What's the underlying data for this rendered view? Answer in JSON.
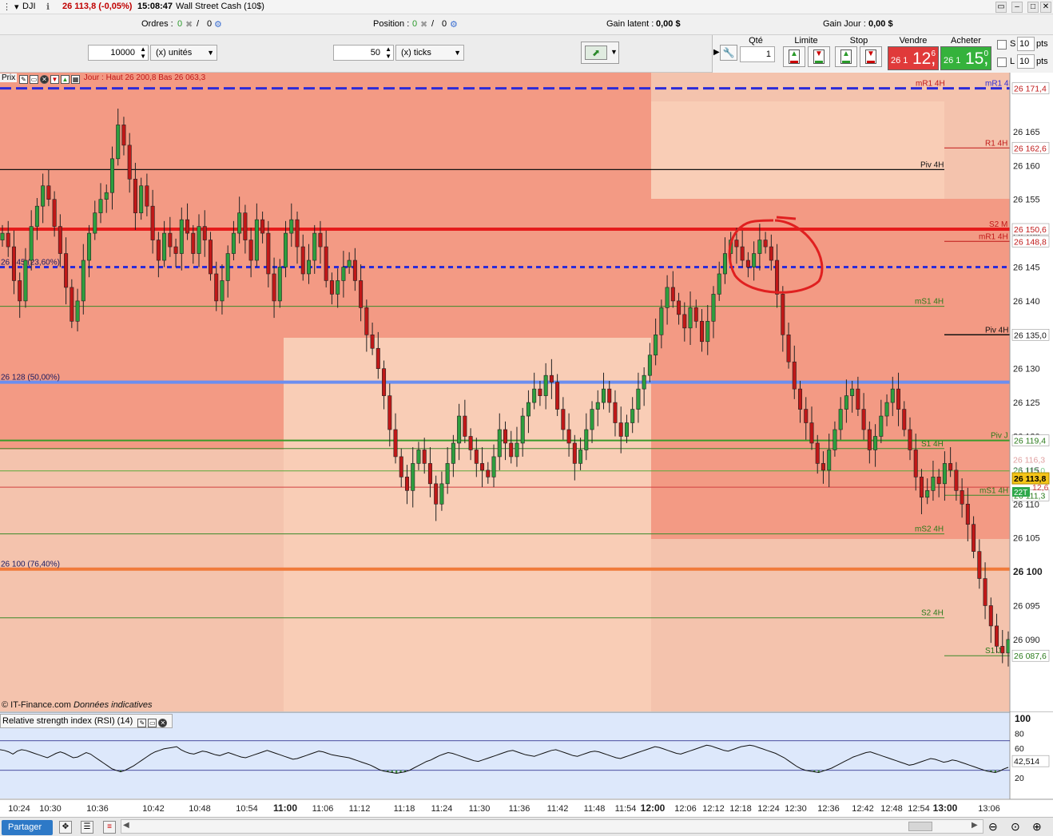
{
  "titlebar": {
    "symbol": "DJI",
    "price_change": "26 113,8 (-0,05%)",
    "time": "15:08:47",
    "instrument": "Wall Street Cash (10$)"
  },
  "statusbar": {
    "orders_label": "Ordres :",
    "orders_value": "0",
    "orders_value2": "0",
    "position_label": "Position :",
    "position_value": "0",
    "position_value2": "0",
    "gain_latent_label": "Gain latent :",
    "gain_latent_value": "0,00 $",
    "gain_jour_label": "Gain Jour :",
    "gain_jour_value": "0,00 $"
  },
  "tradebar": {
    "quantity_value": "10000",
    "quantity_unit": "(x) unités",
    "ticks_value": "50",
    "ticks_unit": "(x) ticks",
    "qte_label": "Qté",
    "qte_value": "1",
    "limite_label": "Limite",
    "stop_label": "Stop",
    "vendre_label": "Vendre",
    "acheter_label": "Acheter",
    "sell_small": "26 1",
    "sell_big": "12,",
    "sell_sup": "6",
    "buy_small": "26 1",
    "buy_big": "15,",
    "buy_sup": "0",
    "s_label": "S",
    "l_label": "L",
    "pts_value_s": "10",
    "pts_value_l": "10",
    "pts_label": "pts"
  },
  "chart_header": {
    "prix_label": "Prix",
    "jour_info": "Jour : Haut 26 200,8 Bas 26 063,3"
  },
  "footer_note": {
    "copyright": "© IT-Finance.com",
    "note": "Données indicatives"
  },
  "rsi_header": {
    "label": "Relative strength index (RSI) (14)"
  },
  "bottombar": {
    "partager_label": "Partager"
  },
  "colors": {
    "zone_dark": "#f39a84",
    "zone_light": "#f9cdb6",
    "zone_base": "#f4c3ad",
    "resistance_red": "#e51b1b",
    "fib_blue_dashed": "#2b2bd9",
    "fib_50_blue": "#6b8ef0",
    "fib_76_orange": "#f07a3a",
    "candle_up": "#2e9e3e",
    "candle_down": "#c01818",
    "annotation_circle": "#e02020"
  },
  "chart_data": {
    "type": "candlestick",
    "y_axis_ticks": [
      26165,
      26160,
      26155,
      26150,
      26145,
      26140,
      26135,
      26130,
      26125,
      26120,
      26115,
      26110,
      26105,
      26100,
      26095,
      26090
    ],
    "y_axis_tick_labels": [
      "26 165",
      "26 160",
      "26 155",
      "26 150",
      "26 145",
      "26 140",
      "26 135",
      "26 130",
      "26 125",
      "26 120",
      "26 115",
      "26 110",
      "26 105",
      "26 100",
      "26 095",
      "26 090"
    ],
    "ylim": [
      26083.5,
      26172.3
    ],
    "x_axis_tick_labels": [
      "10:24",
      "10:30",
      "10:36",
      "10:42",
      "10:48",
      "10:54",
      "11:00",
      "11:06",
      "11:12",
      "11:18",
      "11:24",
      "11:30",
      "11:36",
      "11:42",
      "11:48",
      "11:54",
      "12:00",
      "12:06",
      "12:12",
      "12:18",
      "12:24",
      "12:30",
      "12:36",
      "12:42",
      "12:48",
      "12:54",
      "13:00",
      "13:06"
    ],
    "x_axis_bold": [
      "11:00",
      "12:00",
      "13:00"
    ],
    "horizontal_levels": [
      {
        "label": "mR1 4H",
        "value": 26171.4,
        "axis_label": "26 171,4"
      },
      {
        "label": "R1 4H",
        "value": 26162.6,
        "axis_label": "26 162,6"
      },
      {
        "label": "Piv 4H",
        "value": 26159.4
      },
      {
        "label": "S2 M",
        "value": 26150.6,
        "axis_label": "26 150,6"
      },
      {
        "label": "mR1 4H",
        "value": 26148.8,
        "axis_label": "26 148,8"
      },
      {
        "label": "26 145 (23,60%)",
        "value": 26145
      },
      {
        "label": "mS1 4H",
        "value": 26139.2
      },
      {
        "label": "Piv 4H",
        "value": 26135.0,
        "axis_label": "26 135,0"
      },
      {
        "label": "26 128 (50,00%)",
        "value": 26128
      },
      {
        "label": "Piv J",
        "value": 26119.4,
        "axis_label": "26 119,4"
      },
      {
        "label": "S1 4H",
        "value": 26118.2
      },
      {
        "label": "mS1 4H",
        "value": 26111.3,
        "axis_label": "26 111,3"
      },
      {
        "label": "mS2 4H",
        "value": 26105.6
      },
      {
        "label": "26 100 (76,40%)",
        "value": 26100.4
      },
      {
        "label": "S2 4H",
        "value": 26093.2
      },
      {
        "label": "S1 J",
        "value": 26087.6,
        "axis_label": "26 087,6"
      }
    ],
    "axis_extra_labels": [
      "26 116,3",
      "26 115,0",
      "12,6"
    ],
    "current_price": {
      "value": 26113.8,
      "label": "26 113,8",
      "tag": "22T"
    },
    "series": [
      {
        "close": [
          26150,
          26148,
          26143,
          26140,
          26146,
          26151,
          26154,
          26157,
          26155,
          26151,
          26147,
          26142,
          26137,
          26140,
          26146,
          26150,
          26153,
          26155,
          26156,
          26161,
          26166,
          26163,
          26158,
          26153,
          26157,
          26154,
          26149,
          26146,
          26150,
          26148,
          26147,
          26152,
          26150,
          26147,
          26151,
          26149,
          26144,
          26140,
          26143,
          26147,
          26150,
          26153,
          26149,
          26146,
          26152,
          26150,
          26144,
          26140,
          26145,
          26150,
          26152,
          26148,
          26144,
          26146,
          26150,
          26148,
          26143,
          26141,
          26143,
          26145,
          26146,
          26143,
          26139,
          26135,
          26133,
          26130,
          26126,
          26121,
          26117,
          26114,
          26112,
          26116,
          26118,
          26116,
          26113,
          26110,
          26113,
          26116,
          26119,
          26123,
          26120,
          26118,
          26116,
          26115,
          26114,
          26117,
          26121,
          26119,
          26117,
          26119,
          26123,
          26125,
          26127,
          26126,
          26129,
          26128,
          26124,
          26121,
          26119,
          26116,
          26118,
          26121,
          26124,
          26125,
          26127,
          26125,
          26122,
          26120,
          26122,
          26124,
          26127,
          26129,
          26132,
          26135,
          26139,
          26142,
          26140,
          26138,
          26136,
          26139,
          26137,
          26134,
          26137,
          26141,
          26144,
          26147,
          26149,
          26148,
          26146,
          26145,
          26147,
          26149,
          26148,
          26146,
          26141,
          26135,
          26131,
          26127,
          26124,
          26122,
          26119,
          26116,
          26115,
          26118,
          26121,
          26124,
          26126,
          26127,
          26124,
          26121,
          26118,
          26120,
          26123,
          26125,
          26127,
          26124,
          26121,
          26118,
          26114,
          26111,
          26112,
          26114,
          26113,
          26116,
          26115,
          26112,
          26110,
          26107,
          26103,
          26099,
          26095,
          26092,
          26089,
          26088,
          26090
        ]
      }
    ],
    "rsi": {
      "ticks": [
        100,
        80,
        60,
        40,
        20
      ],
      "levels": [
        70,
        30
      ],
      "current_label": "42,514",
      "ylim": [
        10,
        100
      ],
      "values": [
        58,
        57,
        55,
        52,
        56,
        58,
        57,
        55,
        53,
        51,
        49,
        47,
        50,
        53,
        55,
        53,
        50,
        47,
        48,
        51,
        54,
        52,
        48,
        44,
        40,
        36,
        32,
        30,
        28,
        30,
        33,
        36,
        40,
        44,
        48,
        52,
        55,
        57,
        59,
        60,
        61,
        62,
        58,
        55,
        53,
        52,
        54,
        56,
        55,
        53,
        51,
        50,
        52,
        54,
        52,
        50,
        48,
        47,
        49,
        51,
        53,
        55,
        57,
        55,
        53,
        51,
        49,
        47,
        45,
        46,
        48,
        50,
        52,
        54,
        56,
        55,
        53,
        51,
        50,
        49,
        48,
        47,
        45,
        43,
        41,
        39,
        37,
        34,
        31,
        29,
        28,
        27,
        26,
        27,
        28,
        30,
        33,
        36,
        39,
        42,
        44,
        47,
        50,
        52,
        54,
        53,
        51,
        49,
        47,
        45,
        43,
        42,
        44,
        46,
        48,
        50,
        52,
        54,
        56,
        57,
        55,
        53,
        51,
        50,
        49,
        51,
        53,
        55,
        57,
        58,
        56,
        54,
        52,
        50,
        49,
        51,
        53,
        55,
        56,
        55,
        53,
        51,
        49,
        47,
        46,
        48,
        50,
        52,
        54,
        56,
        58,
        60,
        62,
        61,
        59,
        57,
        55,
        53,
        52,
        54,
        56,
        58,
        60,
        62,
        64,
        63,
        61,
        59,
        57,
        56,
        58,
        60,
        62,
        63,
        64,
        63,
        61,
        59,
        57,
        55,
        53,
        50,
        47,
        43,
        39,
        35,
        32,
        30,
        29,
        28,
        27,
        29,
        31,
        33,
        36,
        39,
        42,
        45,
        48,
        50,
        52,
        54,
        55,
        53,
        51,
        49,
        47,
        45,
        43,
        41,
        39,
        37,
        38,
        40,
        42,
        44,
        46,
        45,
        43,
        41,
        42,
        44,
        43,
        41,
        39,
        37,
        35,
        33,
        31,
        29,
        28,
        27,
        29,
        32,
        34
      ]
    }
  }
}
